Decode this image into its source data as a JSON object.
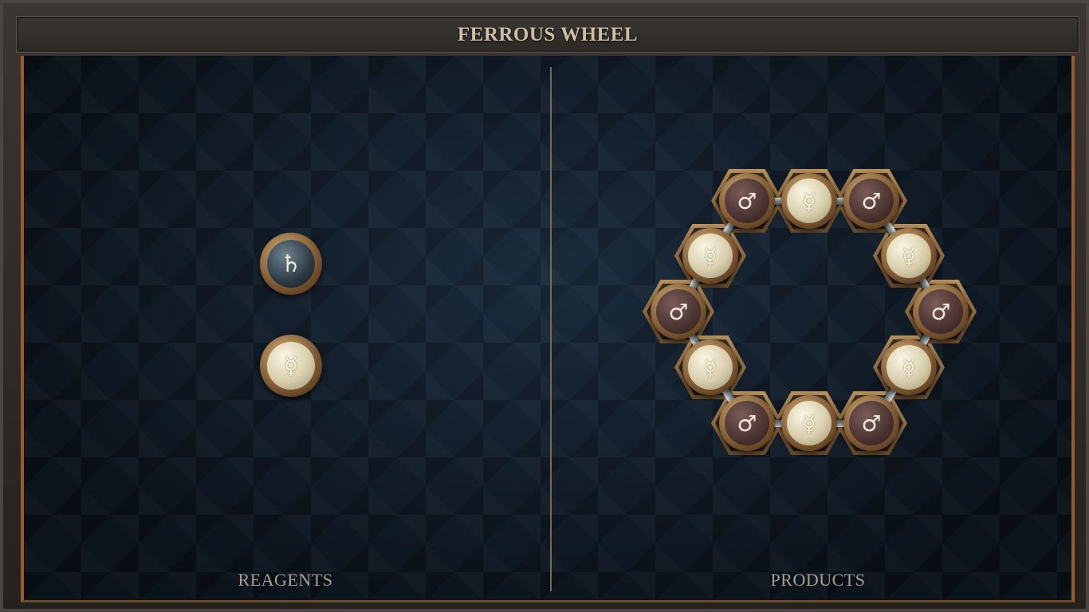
{
  "title": "FERROUS WHEEL",
  "panels": {
    "reagents_label": "REAGENTS",
    "products_label": "PRODUCTS"
  },
  "reagents": [
    {
      "element": "lead",
      "symbol": "♄"
    },
    {
      "element": "quicksilver",
      "symbol": "☿"
    }
  ],
  "product": {
    "atoms": [
      {
        "element": "iron",
        "symbol": "♂"
      },
      {
        "element": "quicksilver",
        "symbol": "☿"
      },
      {
        "element": "iron",
        "symbol": "♂"
      },
      {
        "element": "quicksilver",
        "symbol": "☿"
      },
      {
        "element": "iron",
        "symbol": "♂"
      },
      {
        "element": "quicksilver",
        "symbol": "☿"
      },
      {
        "element": "iron",
        "symbol": "♂"
      },
      {
        "element": "quicksilver",
        "symbol": "☿"
      },
      {
        "element": "iron",
        "symbol": "♂"
      },
      {
        "element": "quicksilver",
        "symbol": "☿"
      },
      {
        "element": "iron",
        "symbol": "♂"
      },
      {
        "element": "quicksilver",
        "symbol": "☿"
      }
    ]
  },
  "colors": {
    "board": "#142231",
    "frame_accent": "#9a5a2a",
    "title_text": "#cdbfa8",
    "label_text": "#aa9f92"
  }
}
